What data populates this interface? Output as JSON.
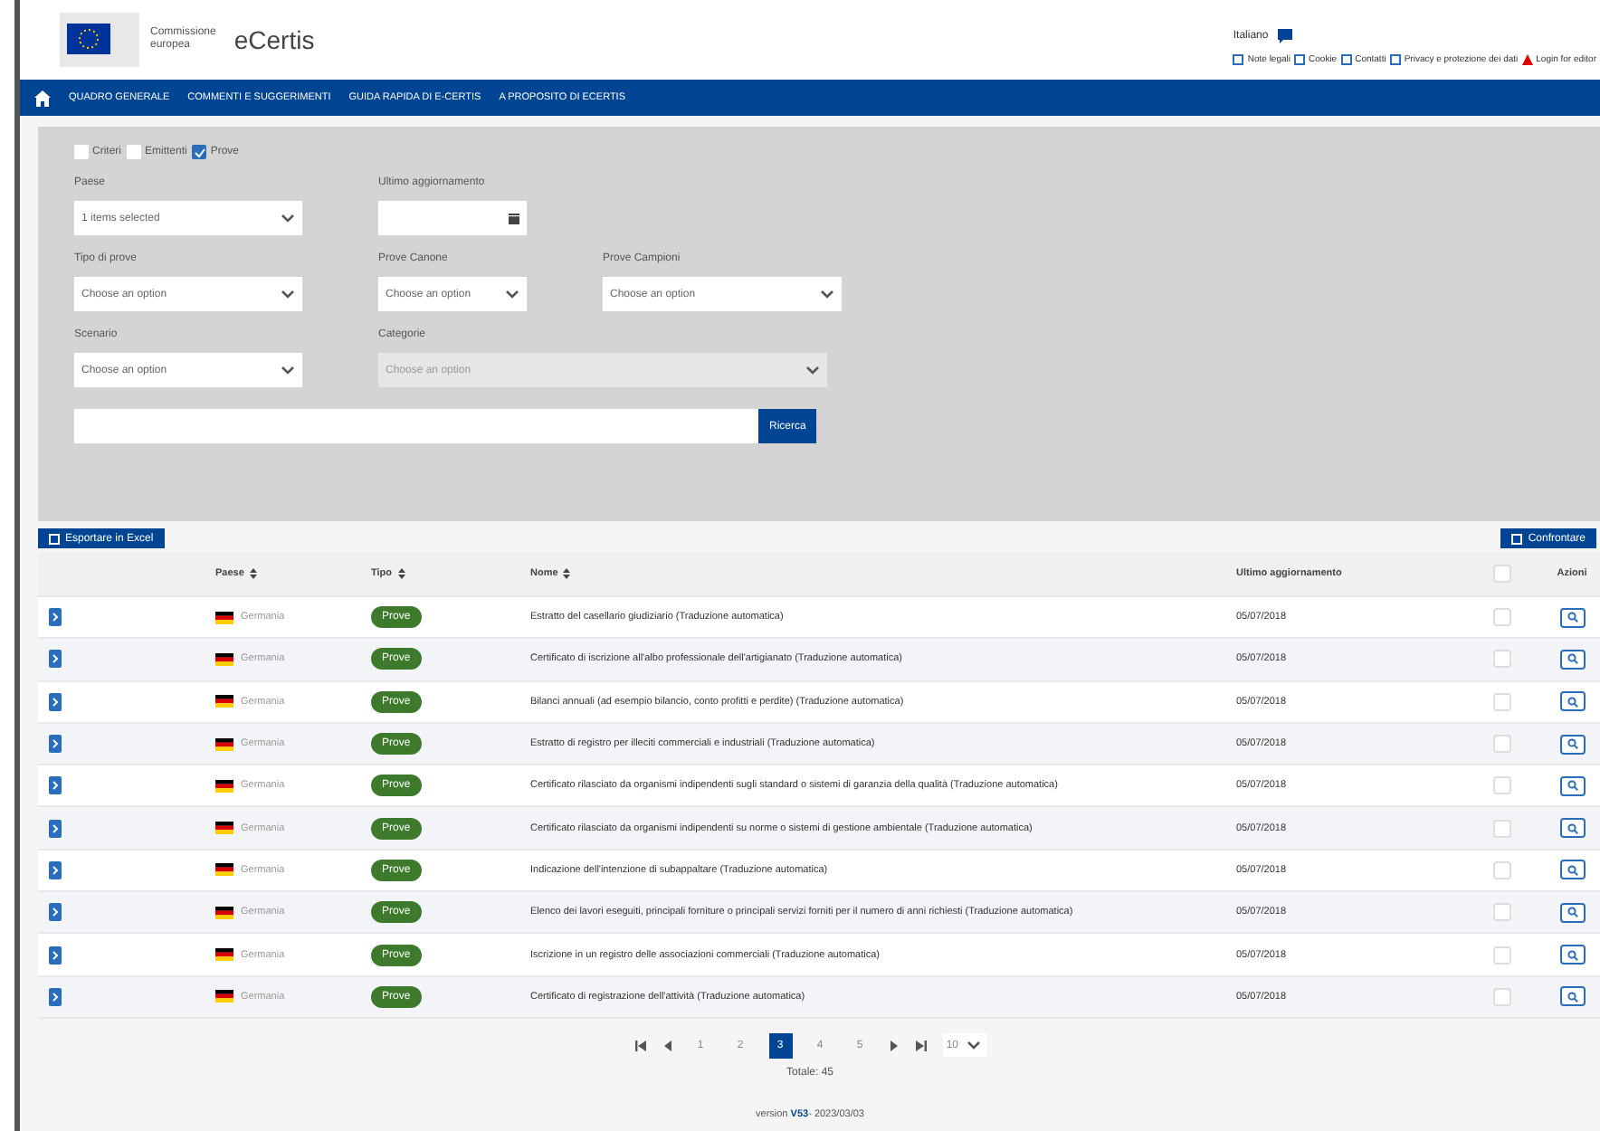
{
  "header": {
    "logo_text": [
      "Commissione",
      "europea"
    ],
    "site_title": "eCertis",
    "language": "Italiano",
    "links": [
      "Note legali",
      "Cookie",
      "Contatti",
      "Privacy e protezione dei dati",
      "Login for editor"
    ]
  },
  "nav": {
    "items": [
      "QUADRO GENERALE",
      "COMMENTI E SUGGERIMENTI",
      "GUIDA RAPIDA DI E-CERTIS",
      "A PROPOSITO DI ECERTIS"
    ]
  },
  "filters": {
    "types": [
      {
        "label": "Criteri",
        "checked": false
      },
      {
        "label": "Emittenti",
        "checked": false
      },
      {
        "label": "Prove",
        "checked": true
      }
    ],
    "fields": [
      {
        "label": "Paese",
        "value": "1 items selected",
        "kind": "select",
        "disabled": false
      },
      {
        "label": "Ultimo aggiornamento",
        "kind": "date",
        "disabled": false
      },
      {
        "label": "Tipo di prove",
        "placeholder": "Choose an option",
        "kind": "select",
        "disabled": false
      },
      {
        "label": "Prove Canone",
        "placeholder": "Choose an option",
        "kind": "select",
        "disabled": false
      },
      {
        "label": "Prove Campioni",
        "placeholder": "Choose an option",
        "kind": "select",
        "disabled": false
      },
      {
        "label": "Scenario",
        "placeholder": "Choose an option",
        "kind": "select",
        "disabled": false
      },
      {
        "label": "Categorie",
        "placeholder": "Choose an option",
        "kind": "select",
        "disabled": true
      }
    ],
    "search_button": "Ricerca"
  },
  "toolbar": {
    "export": "Esportare in Excel",
    "compare": "Confrontare"
  },
  "table": {
    "columns": [
      "Paese",
      "Tipo",
      "Nome",
      "Ultimo aggiornamento",
      "Azioni"
    ],
    "all_checked": false,
    "rows": [
      {
        "country": "Germania",
        "type": "Prove",
        "name": "Estratto del casellario giudiziario (Traduzione automatica)",
        "date": "05/07/2018",
        "checked": false
      },
      {
        "country": "Germania",
        "type": "Prove",
        "name": "Certificato di iscrizione all'albo professionale dell'artigianato (Traduzione automatica)",
        "date": "05/07/2018",
        "checked": false
      },
      {
        "country": "Germania",
        "type": "Prove",
        "name": "Bilanci annuali (ad esempio bilancio, conto profitti e perdite) (Traduzione automatica)",
        "date": "05/07/2018",
        "checked": false
      },
      {
        "country": "Germania",
        "type": "Prove",
        "name": "Estratto di registro per illeciti commerciali e industriali (Traduzione automatica)",
        "date": "05/07/2018",
        "checked": false
      },
      {
        "country": "Germania",
        "type": "Prove",
        "name": "Certificato rilasciato da organismi indipendenti sugli standard o sistemi di garanzia della qualità (Traduzione automatica)",
        "date": "05/07/2018",
        "checked": false
      },
      {
        "country": "Germania",
        "type": "Prove",
        "name": "Certificato rilasciato da organismi indipendenti su norme o sistemi di gestione ambientale (Traduzione automatica)",
        "date": "05/07/2018",
        "checked": false
      },
      {
        "country": "Germania",
        "type": "Prove",
        "name": "Indicazione dell'intenzione di subappaltare (Traduzione automatica)",
        "date": "05/07/2018",
        "checked": false
      },
      {
        "country": "Germania",
        "type": "Prove",
        "name": "Elenco dei lavori eseguiti, principali forniture o principali servizi forniti per il numero di anni richiesti (Traduzione automatica)",
        "date": "05/07/2018",
        "checked": false
      },
      {
        "country": "Germania",
        "type": "Prove",
        "name": "Iscrizione in un registro delle associazioni commerciali (Traduzione automatica)",
        "date": "05/07/2018",
        "checked": false
      },
      {
        "country": "Germania",
        "type": "Prove",
        "name": "Certificato di registrazione dell'attività (Traduzione automatica)",
        "date": "05/07/2018",
        "checked": false
      }
    ]
  },
  "pagination": {
    "pages": [
      {
        "label": "1",
        "selected": false
      },
      {
        "label": "2",
        "selected": false
      },
      {
        "label": "3",
        "selected": true
      },
      {
        "label": "4",
        "selected": false
      },
      {
        "label": "5",
        "selected": false
      }
    ],
    "rows_select": "10",
    "total": "Totale: 45"
  },
  "footer": {
    "text": "version **V53**- 2023/03/03"
  }
}
